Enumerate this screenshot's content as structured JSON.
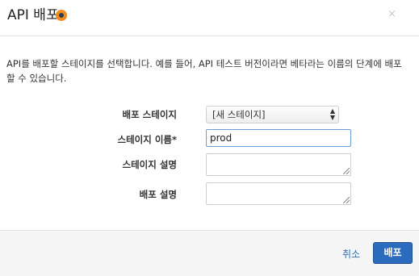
{
  "dialog": {
    "title": "API 배포",
    "close_glyph": "×",
    "description": "API를 배포할 스테이지를 선택합니다. 예를 들어, API 테스트 버전이라면 베타라는 이름의 단계에 배포할 수 있습니다.",
    "fields": {
      "stage_label": "배포 스테이지",
      "stage_selected": "[새 스테이지]",
      "stage_name_label": "스테이지 이름*",
      "stage_name_value": "prod",
      "stage_desc_label": "스테이지 설명",
      "deploy_desc_label": "배포 설명"
    },
    "footer": {
      "cancel_label": "취소",
      "deploy_label": "배포"
    }
  },
  "colors": {
    "primary_button": "#2a6bbd",
    "link": "#2d6bb3",
    "info_icon": "#f28c1e"
  }
}
